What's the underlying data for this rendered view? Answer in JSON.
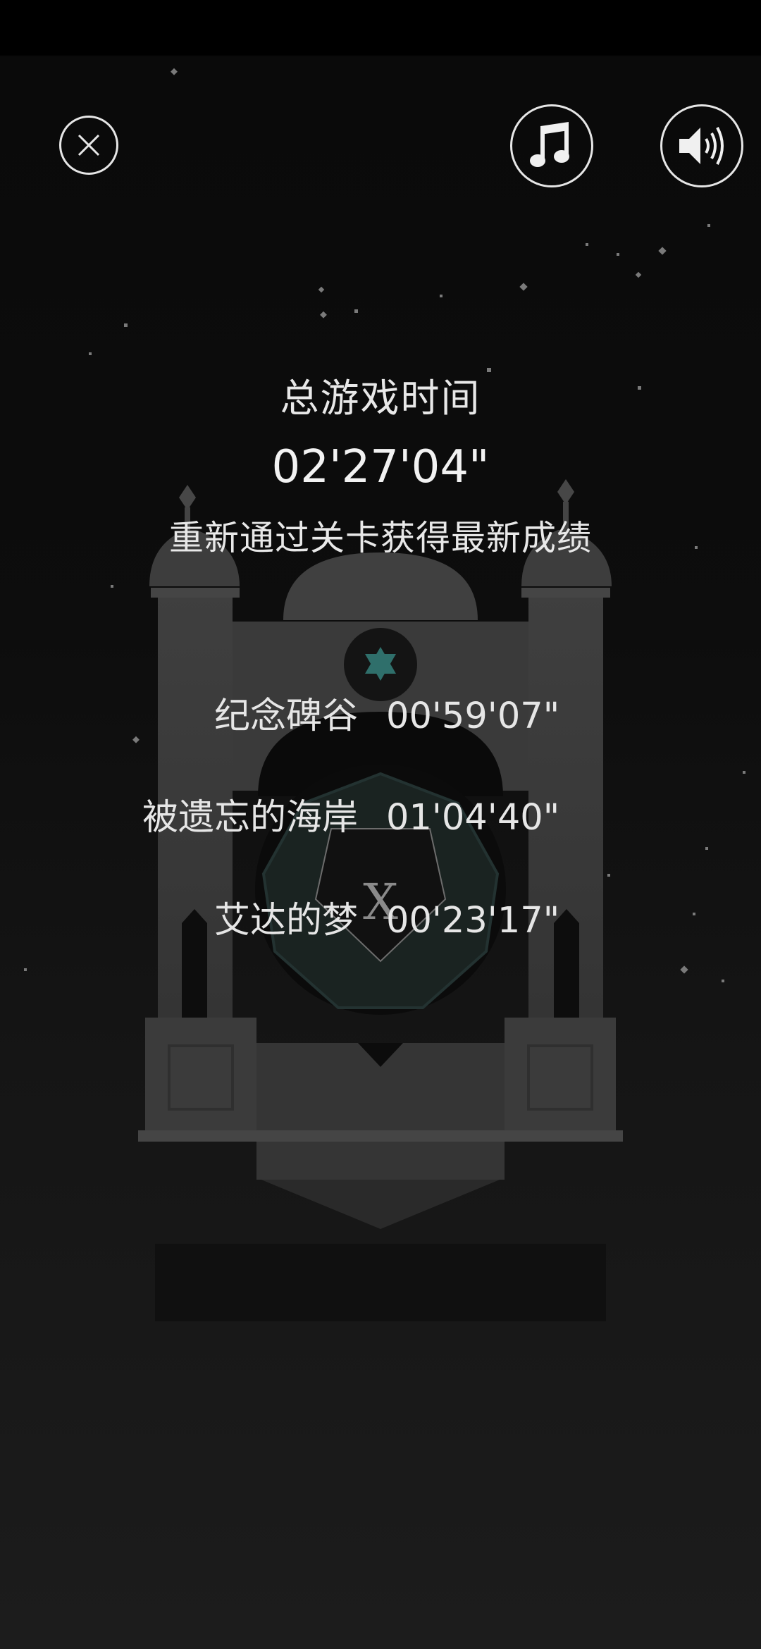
{
  "colors": {
    "background_top": "#000000",
    "background_bottom": "#1c1c1c",
    "text": "#e8e8e8",
    "icon_stroke": "#e6e6e6",
    "gem_accent": "#2f6f6b",
    "monument_stone": "#3a3a3a"
  },
  "toolbar": {
    "close_icon": "close-icon",
    "music_icon": "music-note-icon",
    "sound_icon": "speaker-icon"
  },
  "summary": {
    "title": "总游戏时间",
    "total_time": "02'27'04\"",
    "hint": "重新通过关卡获得最新成绩"
  },
  "levels": [
    {
      "name": "纪念碑谷",
      "time": "00'59'07\""
    },
    {
      "name": "被遗忘的海岸",
      "time": "01'04'40\""
    },
    {
      "name": "艾达的梦",
      "time": "00'23'17\""
    }
  ]
}
